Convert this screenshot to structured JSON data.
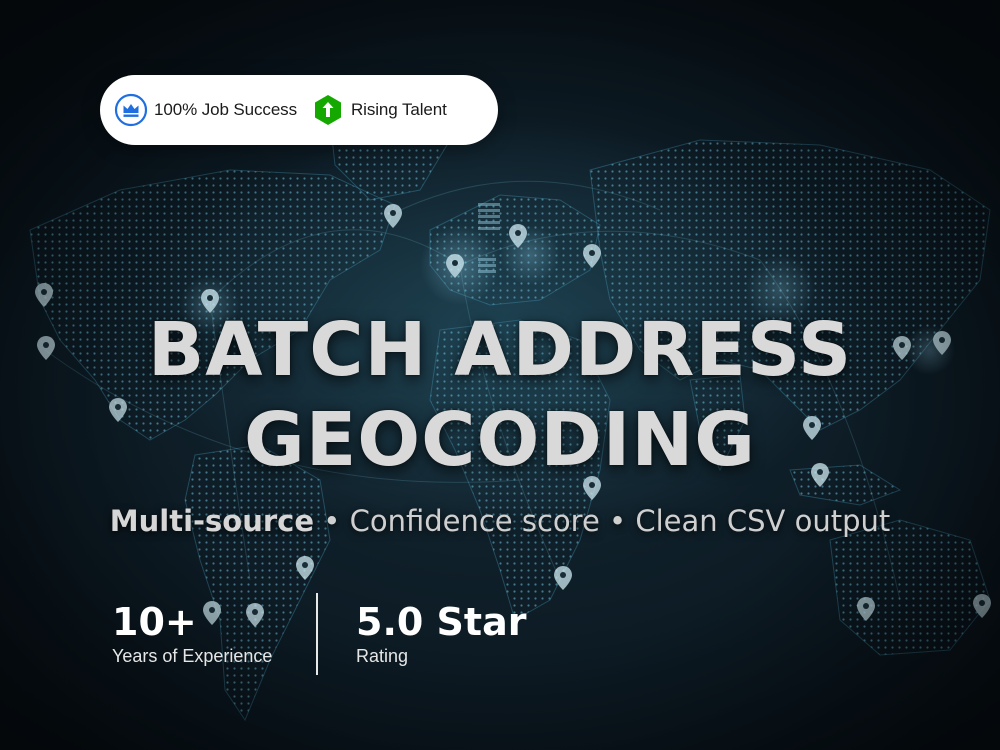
{
  "badges": {
    "job_success_label": "100% Job Success",
    "rising_talent_label": "Rising Talent",
    "job_success_icon": "crown-icon",
    "rising_talent_icon": "arrow-up-icon"
  },
  "headline": {
    "line1": "BATCH ADDRESS",
    "line2": "GEOCODING"
  },
  "subtitle": {
    "part1": "Multi-source",
    "separator": " • ",
    "part2": "Confidence score",
    "part3": "Clean CSV output"
  },
  "stats": {
    "experience_value": "10+",
    "experience_label": "Years of Experience",
    "rating_value": "5.0 Star",
    "rating_label": "Rating"
  },
  "background": {
    "theme": "dark world map with location pins",
    "icon": "map-pin-icon"
  },
  "colors": {
    "background": "#0a1620",
    "map_glow": "#5fb8d6",
    "pin": "#c9e6f0",
    "badge_blue": "#1f6fe0",
    "badge_green": "#14a800",
    "text": "#d9d9d9"
  }
}
